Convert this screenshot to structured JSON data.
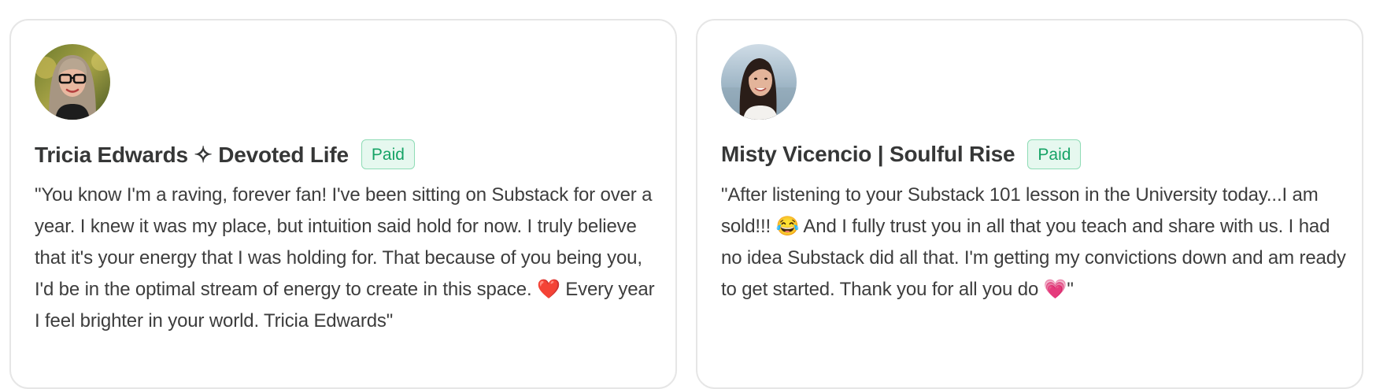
{
  "testimonials": [
    {
      "name": "Tricia Edwards ✧ Devoted Life",
      "badge": "Paid",
      "quote": "\"You know I'm a raving, forever fan! I've been sitting on Substack for over a year. I knew it was my place, but intuition said hold for now. I truly believe that it's your energy that I was holding for. That because of you being you, I'd be in the optimal stream of energy to create in this space. ❤️ Every year I feel brighter in your world. Tricia Edwards\""
    },
    {
      "name": "Misty Vicencio | Soulful Rise",
      "badge": "Paid",
      "quote": "\"After listening to your Substack 101 lesson in the University today...I am sold!!! 😂 And I fully trust you in all that you teach and share with us. I had no idea Substack did all that. I'm getting my convictions down and am ready to get started. Thank you for all you do 💗\""
    }
  ],
  "colors": {
    "badge_text": "#16a366",
    "badge_bg": "#e6f8ef",
    "badge_border": "#8fdcb6",
    "name_text": "#363737",
    "body_text": "#3d3d3d",
    "card_border": "#e6e6e6"
  }
}
